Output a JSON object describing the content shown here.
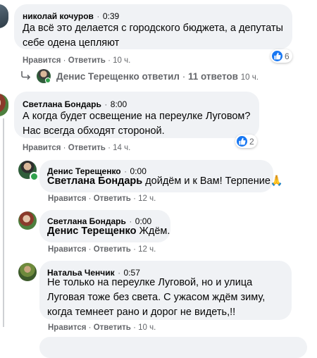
{
  "comments": [
    {
      "author": "николай кочуров",
      "sep": "·",
      "time": "0:39",
      "text_lines": [
        "Да всё это делается с городского бюджета, а депутаты",
        "себе одена цепляют"
      ],
      "actions": {
        "like": "Нравится",
        "dot1": "·",
        "reply": "Ответить",
        "dot2": "·",
        "ago": "10 ч."
      },
      "reactions": "6"
    },
    {
      "replies_summary": {
        "name": "Денис Терещенко",
        "verb": "ответил",
        "dot": "·",
        "count": "11 ответов",
        "ago": "10 ч."
      }
    },
    {
      "author": "Светлана Бондарь",
      "sep": "·",
      "time": "8:00",
      "text_lines": [
        "А когда будет освещение на переулке Луговом?",
        "Нас всегда обходят стороной."
      ],
      "actions": {
        "like": "Нравится",
        "dot1": "·",
        "reply": "Ответить",
        "dot2": "·",
        "ago": "14 ч."
      },
      "reactions": "2"
    },
    {
      "author": "Денис Терещенко",
      "sep": "·",
      "time": "0:00",
      "mention": "Светлана Бондарь",
      "text": " дойдём и к Вам! Терпение",
      "emoji": "🙏",
      "actions": {
        "like": "Нравится",
        "dot1": "·",
        "reply": "Ответить",
        "dot2": "·",
        "ago": "12 ч."
      }
    },
    {
      "author": "Светлана Бондарь",
      "sep": "·",
      "time": "0:00",
      "mention": "Денис Терещенко",
      "text": " Ждём.",
      "actions": {
        "like": "Нравится",
        "dot1": "·",
        "reply": "Ответить",
        "dot2": "·",
        "ago": "12 ч."
      }
    },
    {
      "author": "Натальа Ченчик",
      "sep": "·",
      "time": "0:57",
      "text_lines": [
        "Не только на переулке Луговой, но и улица",
        "Луговая тоже без света. С ужасом ждём зиму,",
        "когда темнеет рано и дорог не видеть,!!"
      ],
      "actions": {
        "like": "Нравится",
        "dot1": "·",
        "reply": "Ответить",
        "dot2": "·",
        "ago": "10 ч."
      }
    }
  ],
  "colors": {
    "bubble": "#f0f2f5",
    "like_blue": "#1877f2",
    "muted": "#65676b",
    "online": "#31a24c"
  },
  "icons": [
    "like-icon",
    "reply-arrow-icon",
    "avatar"
  ]
}
